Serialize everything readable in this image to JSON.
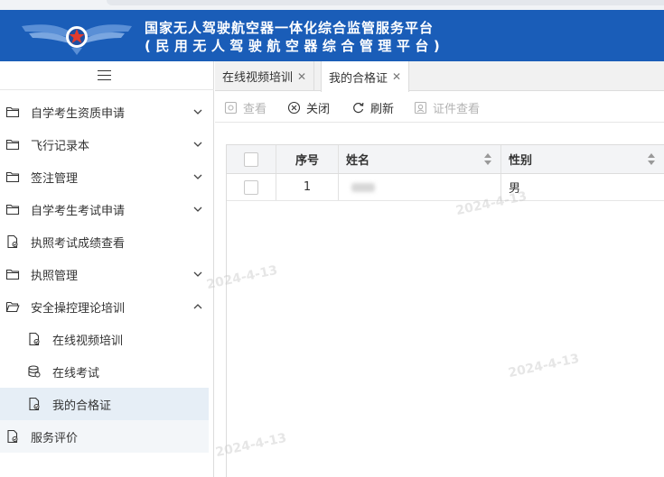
{
  "header": {
    "title_main": "国家无人驾驶航空器一体化综合监管服务平台",
    "title_sub": "(民用无人驾驶航空器综合管理平台)",
    "colors": {
      "header_bg": "#1a5db8",
      "active_item_bg": "#e6eef6"
    }
  },
  "sidebar": {
    "toggle_icon": "hamburger-icon",
    "items": [
      {
        "label": "自学考生资质申请",
        "icon": "folder-icon",
        "expandable": true,
        "expanded": false
      },
      {
        "label": "飞行记录本",
        "icon": "folder-icon",
        "expandable": true,
        "expanded": false
      },
      {
        "label": "签注管理",
        "icon": "folder-icon",
        "expandable": true,
        "expanded": false
      },
      {
        "label": "自学考生考试申请",
        "icon": "folder-icon",
        "expandable": true,
        "expanded": false
      },
      {
        "label": "执照考试成绩查看",
        "icon": "document-icon",
        "expandable": false
      },
      {
        "label": "执照管理",
        "icon": "folder-icon",
        "expandable": true,
        "expanded": false
      },
      {
        "label": "安全操控理论培训",
        "icon": "folder-open-icon",
        "expandable": true,
        "expanded": true
      },
      {
        "label": "在线视频培训",
        "icon": "document-icon",
        "sub": true
      },
      {
        "label": "在线考试",
        "icon": "document-icon",
        "sub": true
      },
      {
        "label": "我的合格证",
        "icon": "document-icon",
        "sub": true,
        "active": true
      },
      {
        "label": "服务评价",
        "icon": "document-icon",
        "expandable": false
      }
    ]
  },
  "tabs": [
    {
      "label": "在线视频培训",
      "active": false
    },
    {
      "label": "我的合格证",
      "active": true
    }
  ],
  "toolbar": {
    "view_label": "查看",
    "close_label": "关闭",
    "refresh_label": "刷新",
    "cert_view_label": "证件查看"
  },
  "table": {
    "columns": [
      "序号",
      "姓名",
      "性别"
    ],
    "rows": [
      {
        "index": "1",
        "name": "",
        "gender": "男"
      }
    ]
  },
  "watermarks": [
    "2024-4-13",
    "2024-4-13",
    "2024-4-13",
    "2024-4-13"
  ]
}
